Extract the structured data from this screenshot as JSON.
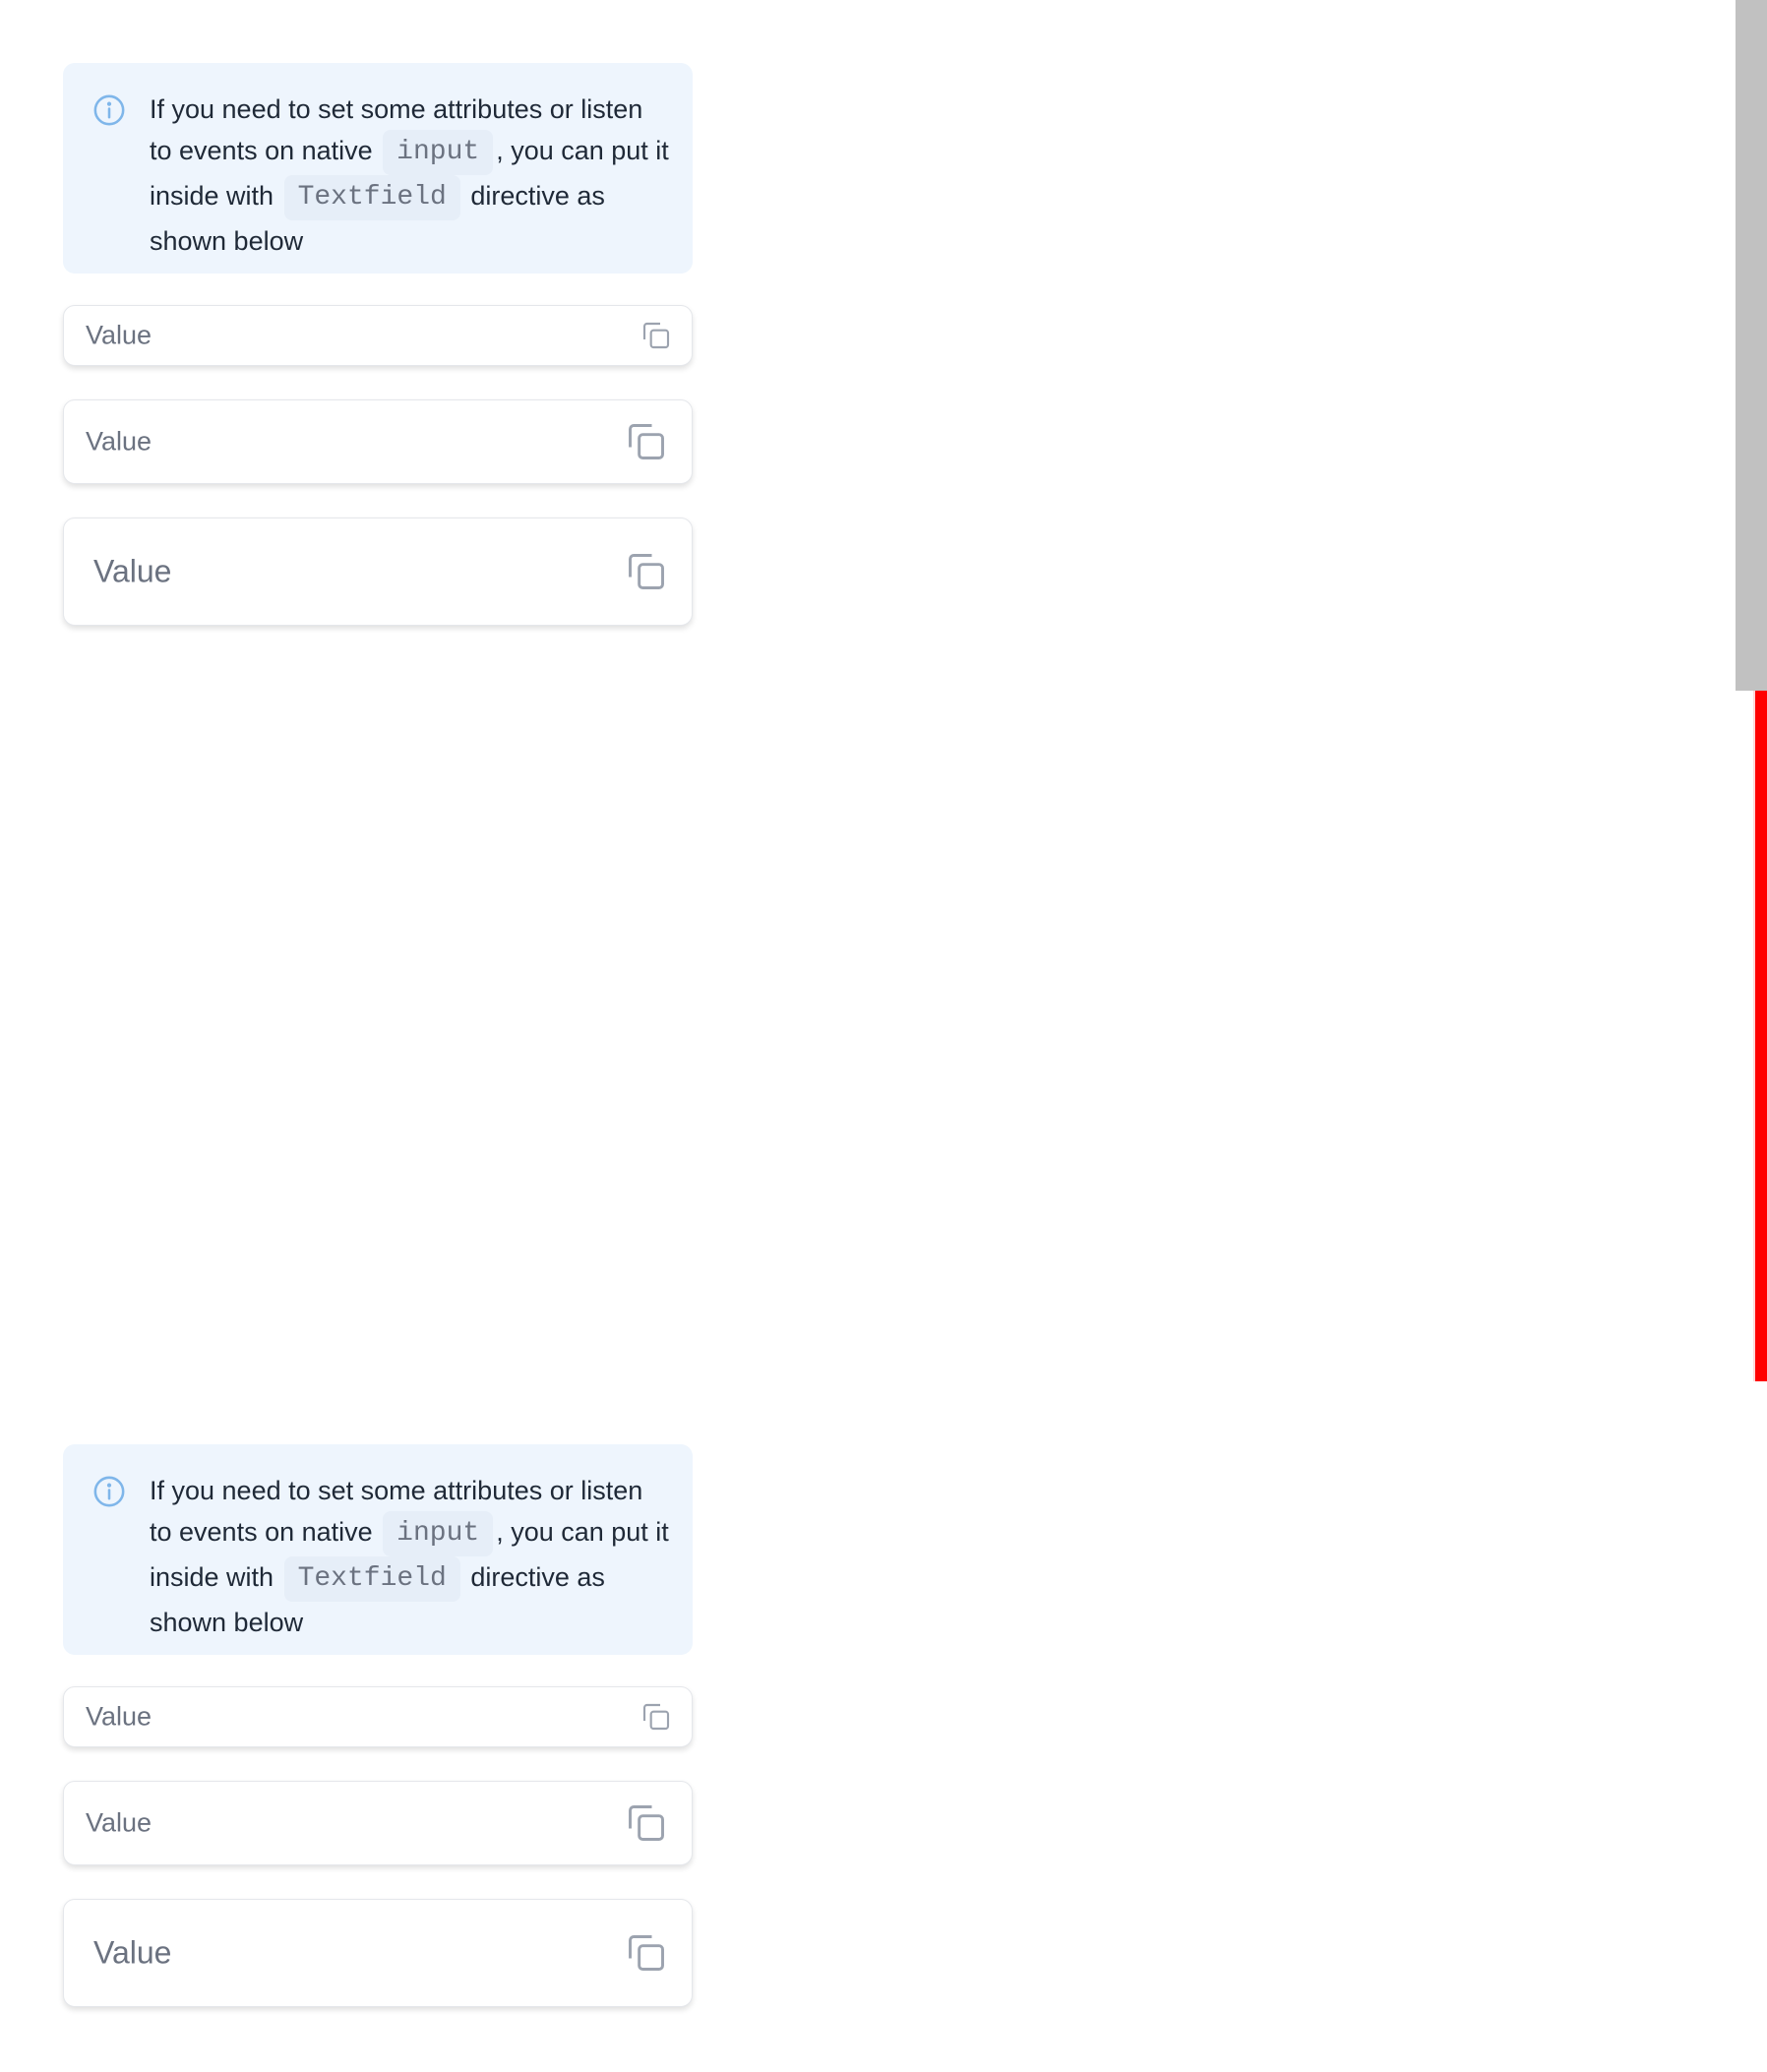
{
  "sections": [
    {
      "callout": {
        "text_before_input": "If you need to set some attributes or listen to events on native",
        "code_input": "input",
        "text_before_textfield": ", you can put it inside with",
        "code_textfield": "Textfield",
        "text_after": "directive as shown below",
        "icon": "info-circle-icon"
      },
      "fields": [
        {
          "label": "Value",
          "icon": "copy-icon",
          "size": "small"
        },
        {
          "label": "Value",
          "icon": "copy-icon",
          "size": "medium"
        },
        {
          "label": "Value",
          "icon": "copy-icon",
          "size": "large"
        }
      ]
    },
    {
      "callout": {
        "text_before_input": "If you need to set some attributes or listen to events on native",
        "code_input": "input",
        "text_before_textfield": ", you can put it inside with",
        "code_textfield": "Textfield",
        "text_after": "directive as shown below",
        "icon": "info-circle-icon"
      },
      "fields": [
        {
          "label": "Value",
          "icon": "copy-icon",
          "size": "small"
        },
        {
          "label": "Value",
          "icon": "copy-icon",
          "size": "medium"
        },
        {
          "label": "Value",
          "icon": "copy-icon",
          "size": "large"
        }
      ]
    }
  ],
  "colors": {
    "callout_background": "#eef5fd",
    "info_icon": "#7fb6ea",
    "code_background": "#e6eef8",
    "field_border": "#e5e7eb",
    "placeholder_text": "#6b7280",
    "scrollbar_track": "#c1c1c1",
    "scrollbar_highlight": "#ff0000"
  }
}
